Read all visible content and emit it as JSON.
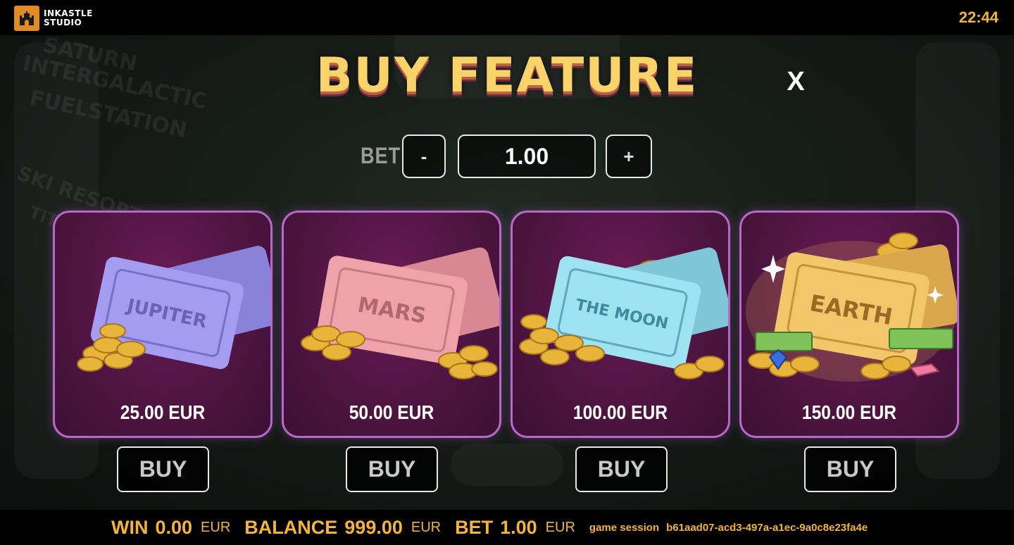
{
  "header": {
    "brand_line1": "INKASTLE",
    "brand_line2": "STUDIO",
    "clock": "22:44",
    "clock_color": "#f3b33d"
  },
  "background": {
    "sign_lines": [
      "SATURN",
      "INTERGALACTIC",
      "FUELSTATION",
      "SKI RESORT",
      "TITAN"
    ]
  },
  "dialog": {
    "title": "BUY FEATURE",
    "close_label": "X",
    "bet": {
      "label": "BET",
      "decrease_label": "-",
      "value": "1.00",
      "increase_label": "+"
    },
    "features": [
      {
        "ticket": "JUPITER",
        "price": "25.00 EUR",
        "buy_label": "BUY",
        "ticket_color": "#a49cf0"
      },
      {
        "ticket": "MARS",
        "price": "50.00 EUR",
        "buy_label": "BUY",
        "ticket_color": "#f0a2aa"
      },
      {
        "ticket": "THE MOON",
        "price": "100.00 EUR",
        "buy_label": "BUY",
        "ticket_color": "#9fe3f2"
      },
      {
        "ticket": "EARTH",
        "price": "150.00 EUR",
        "buy_label": "BUY",
        "ticket_color": "#f2c66b"
      }
    ]
  },
  "footer": {
    "win_label": "WIN",
    "win_value": "0.00",
    "win_currency": "EUR",
    "balance_label": "BALANCE",
    "balance_value": "999.00",
    "balance_currency": "EUR",
    "bet_label": "BET",
    "bet_value": "1.00",
    "bet_currency": "EUR",
    "session_label": "game session",
    "session_id": "b61aad07-acd3-497a-a1ec-9a0c8e23fa4e"
  },
  "accent_color": "#f3b33d",
  "card_border_color": "#b768c9"
}
